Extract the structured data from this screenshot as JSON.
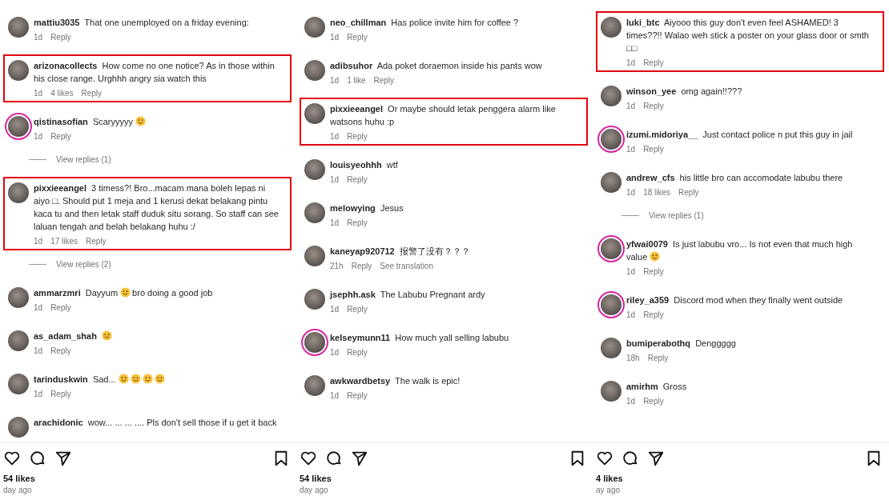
{
  "columns": [
    {
      "comments": [
        {
          "username": "mattiu3035",
          "parts": [
            {
              "kind": "text",
              "text": "That one unemployed on a friday evening:"
            }
          ],
          "time": "1d",
          "reply": "Reply",
          "highlighted": false,
          "story_ring": false
        },
        {
          "username": "arizonacollects",
          "parts": [
            {
              "kind": "text",
              "text": "How come no one notice? As in those within his close range. Urghhh angry sia watch this"
            }
          ],
          "time": "1d",
          "likes": "4 likes",
          "reply": "Reply",
          "highlighted": true,
          "story_ring": false
        },
        {
          "username": "qistinasofian",
          "parts": [
            {
              "kind": "text",
              "text": "Scaryyyyy"
            },
            {
              "kind": "emoji"
            }
          ],
          "time": "1d",
          "reply": "Reply",
          "highlighted": false,
          "story_ring": true,
          "view_replies": "View replies (1)"
        },
        {
          "username": "pixxieeangel",
          "parts": [
            {
              "kind": "text",
              "text": "3 timess?! Bro...macam mana boleh lepas ni aiyo □. Should put 1 meja and 1 kerusi dekat belakang pintu kaca tu and then letak staff duduk situ sorang. So staff can see laluan tengah and belah belakang huhu :/"
            }
          ],
          "time": "1d",
          "likes": "17 likes",
          "reply": "Reply",
          "highlighted": true,
          "story_ring": false,
          "view_replies": "View replies (2)"
        },
        {
          "username": "ammarzmri",
          "parts": [
            {
              "kind": "text",
              "text": "Dayyum"
            },
            {
              "kind": "emoji"
            },
            {
              "kind": "text",
              "text": "bro doing a good job"
            }
          ],
          "time": "1d",
          "reply": "Reply",
          "highlighted": false,
          "story_ring": false
        },
        {
          "username": "as_adam_shah",
          "parts": [
            {
              "kind": "emoji"
            }
          ],
          "time": "1d",
          "reply": "Reply",
          "highlighted": false,
          "story_ring": false
        },
        {
          "username": "tarinduskwin",
          "parts": [
            {
              "kind": "text",
              "text": "Sad..."
            },
            {
              "kind": "emoji"
            },
            {
              "kind": "emoji"
            },
            {
              "kind": "emoji"
            },
            {
              "kind": "emoji"
            }
          ],
          "time": "1d",
          "reply": "Reply",
          "highlighted": false,
          "story_ring": false
        },
        {
          "username": "arachidonic",
          "parts": [
            {
              "kind": "text",
              "text": "wow... ... ... .... Pls don't sell those if u get it back"
            }
          ],
          "highlighted": false,
          "story_ring": false
        }
      ],
      "likes": "54 likes",
      "posted": "day ago"
    },
    {
      "comments": [
        {
          "username": "neo_chillman",
          "parts": [
            {
              "kind": "text",
              "text": "Has police invite him for coffee ?"
            }
          ],
          "time": "1d",
          "reply": "Reply",
          "highlighted": false,
          "story_ring": false
        },
        {
          "username": "adibsuhor",
          "parts": [
            {
              "kind": "text",
              "text": "Ada poket doraemon inside his pants wow"
            }
          ],
          "time": "1d",
          "likes": "1 like",
          "reply": "Reply",
          "highlighted": false,
          "story_ring": false
        },
        {
          "username": "pixxieeangel",
          "parts": [
            {
              "kind": "text",
              "text": "Or maybe should letak penggera alarm like watsons huhu :p"
            }
          ],
          "time": "1d",
          "reply": "Reply",
          "highlighted": true,
          "story_ring": false
        },
        {
          "username": "louisyeohhh",
          "parts": [
            {
              "kind": "text",
              "text": "wtf"
            }
          ],
          "time": "1d",
          "reply": "Reply",
          "highlighted": false,
          "story_ring": false
        },
        {
          "username": "melowying",
          "parts": [
            {
              "kind": "text",
              "text": "Jesus"
            }
          ],
          "time": "1d",
          "reply": "Reply",
          "highlighted": false,
          "story_ring": false
        },
        {
          "username": "kaneyap920712",
          "parts": [
            {
              "kind": "text",
              "text": "报警了没有？？？"
            }
          ],
          "time": "21h",
          "reply": "Reply",
          "translation": "See translation",
          "highlighted": false,
          "story_ring": false
        },
        {
          "username": "jsephh.ask",
          "parts": [
            {
              "kind": "text",
              "text": "The Labubu Pregnant ardy"
            }
          ],
          "time": "1d",
          "reply": "Reply",
          "highlighted": false,
          "story_ring": false
        },
        {
          "username": "kelseymunn11",
          "parts": [
            {
              "kind": "text",
              "text": "How much yall selling labubu"
            }
          ],
          "time": "1d",
          "reply": "Reply",
          "highlighted": false,
          "story_ring": true
        },
        {
          "username": "awkwardbetsy",
          "parts": [
            {
              "kind": "text",
              "text": "The walk is epic!"
            }
          ],
          "time": "1d",
          "reply": "Reply",
          "highlighted": false,
          "story_ring": false
        }
      ],
      "likes": "54 likes",
      "posted": "day ago"
    },
    {
      "comments": [
        {
          "username": "luki_btc",
          "parts": [
            {
              "kind": "text",
              "text": "Aiyooo this guy don't even feel ASHAMED! 3 times??!! Walao weh stick a poster on your glass door or smth □□"
            }
          ],
          "time": "1d",
          "reply": "Reply",
          "highlighted": true,
          "story_ring": false
        },
        {
          "username": "winson_yee",
          "parts": [
            {
              "kind": "text",
              "text": "omg again!!???"
            }
          ],
          "time": "1d",
          "reply": "Reply",
          "highlighted": false,
          "story_ring": false
        },
        {
          "username": "izumi.midoriya__",
          "parts": [
            {
              "kind": "text",
              "text": "Just contact police n put this guy in jail"
            }
          ],
          "time": "1d",
          "reply": "Reply",
          "highlighted": false,
          "story_ring": true
        },
        {
          "username": "andrew_cfs",
          "parts": [
            {
              "kind": "text",
              "text": "his little bro can accomodate labubu there"
            }
          ],
          "time": "1d",
          "likes": "18 likes",
          "reply": "Reply",
          "highlighted": false,
          "story_ring": false,
          "view_replies": "View replies (1)"
        },
        {
          "username": "yfwai0079",
          "parts": [
            {
              "kind": "text",
              "text": "Is just labubu vro... Is not even that much high value"
            },
            {
              "kind": "emoji"
            }
          ],
          "time": "1d",
          "reply": "Reply",
          "highlighted": false,
          "story_ring": true
        },
        {
          "username": "riley_a359",
          "parts": [
            {
              "kind": "text",
              "text": "Discord mod when they finally went outside"
            }
          ],
          "time": "1d",
          "reply": "Reply",
          "highlighted": false,
          "story_ring": true
        },
        {
          "username": "bumiperabothq",
          "parts": [
            {
              "kind": "text",
              "text": "Denggggg"
            }
          ],
          "time": "18h",
          "reply": "Reply",
          "highlighted": false,
          "story_ring": false
        },
        {
          "username": "amirhm",
          "parts": [
            {
              "kind": "text",
              "text": "Gross"
            }
          ],
          "time": "1d",
          "reply": "Reply",
          "highlighted": false,
          "story_ring": false
        }
      ],
      "likes": "4 likes",
      "posted": "ay ago"
    }
  ]
}
